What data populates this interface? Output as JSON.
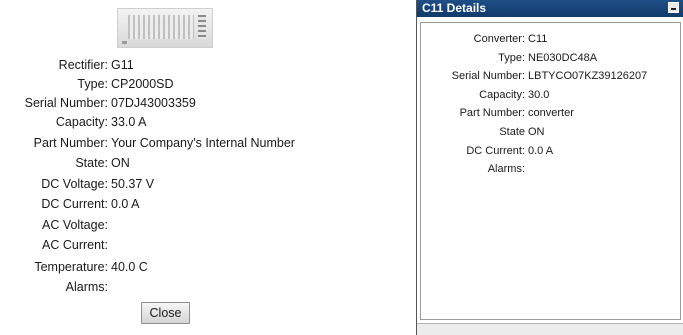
{
  "rectifier_panel": {
    "image_icon": "rectifier-module-image",
    "rows": [
      {
        "label": "Rectifier:",
        "value": "G11"
      },
      {
        "label": "Type:",
        "value": "CP2000SD"
      },
      {
        "label": "Serial Number:",
        "value": "07DJ43003359"
      },
      {
        "label": "Capacity:",
        "value": "33.0 A"
      },
      {
        "label": "Part Number:",
        "value": "Your Company's Internal Number"
      },
      {
        "label": "State:",
        "value": "ON"
      },
      {
        "label": "DC Voltage:",
        "value": "50.37 V"
      },
      {
        "label": "DC Current:",
        "value": "0.0 A"
      },
      {
        "label": "AC Voltage:",
        "value": ""
      },
      {
        "label": "AC Current:",
        "value": ""
      },
      {
        "label": "Temperature:",
        "value": "40.0 C"
      },
      {
        "label": "Alarms:",
        "value": ""
      }
    ],
    "close_label": "Close"
  },
  "converter_window": {
    "title": "C11 Details",
    "titlebar_color": "#164577",
    "minimize_icon": "minimize-icon",
    "rows": [
      {
        "label": "Converter:",
        "value": "C11"
      },
      {
        "label": "Type:",
        "value": "NE030DC48A"
      },
      {
        "label": "Serial Number:",
        "value": "LBTYCO07KZ39126207"
      },
      {
        "label": "Capacity:",
        "value": "30.0"
      },
      {
        "label": "Part Number:",
        "value": "converter"
      },
      {
        "label": "State",
        "value": "ON"
      },
      {
        "label": "DC Current:",
        "value": "0.0 A"
      },
      {
        "label": "Alarms:",
        "value": ""
      }
    ]
  }
}
